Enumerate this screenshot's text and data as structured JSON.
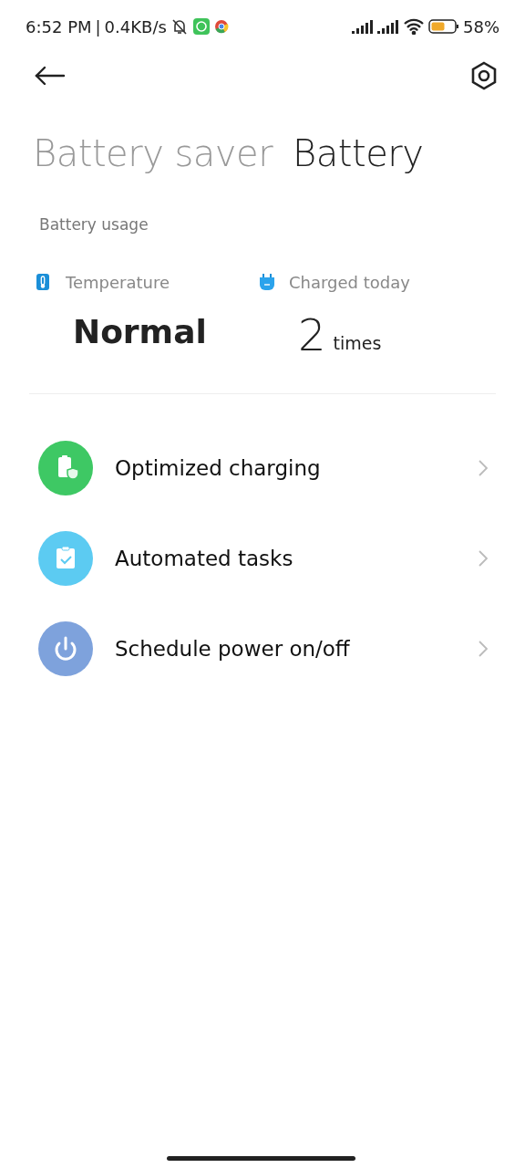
{
  "status_bar": {
    "time": "6:52 PM",
    "separator": "|",
    "speed": "0.4KB/s",
    "battery_percent": "58%"
  },
  "tabs": [
    {
      "label": "Battery saver",
      "selected": false
    },
    {
      "label": "Battery",
      "selected": true
    }
  ],
  "section_title": "Battery usage",
  "stats": [
    {
      "kind": "thermometer",
      "label": "Temperature",
      "value": "Normal"
    },
    {
      "kind": "plug",
      "label": "Charged today",
      "value": "2",
      "unit": "times"
    }
  ],
  "menu": [
    {
      "kind": "charging",
      "color": "#3ec864",
      "label": "Optimized charging"
    },
    {
      "kind": "tasks",
      "color": "#5ccbf2",
      "label": "Automated tasks"
    },
    {
      "kind": "power",
      "color": "#7ea2dc",
      "label": "Schedule power on/off"
    }
  ]
}
